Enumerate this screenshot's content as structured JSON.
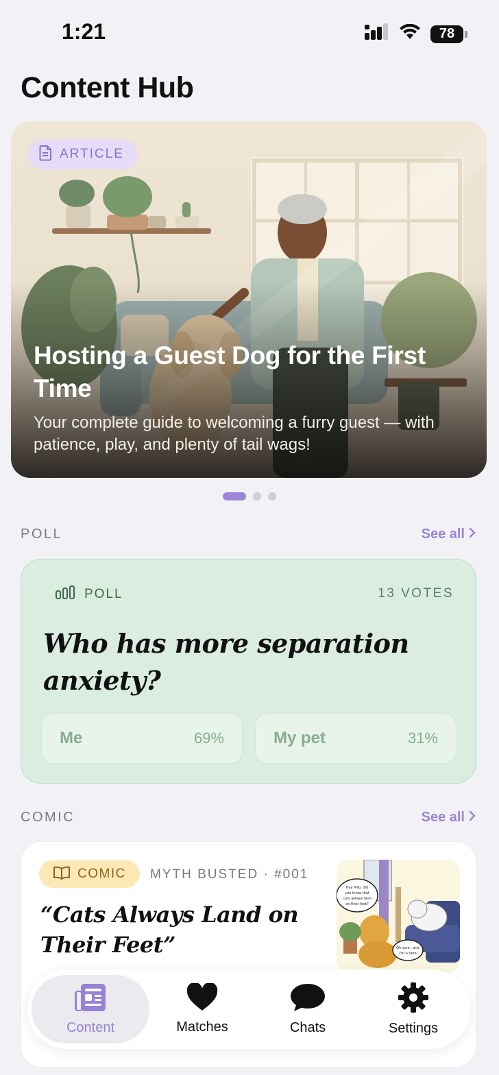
{
  "status": {
    "time": "1:21",
    "battery": "78"
  },
  "page": {
    "title": "Content Hub"
  },
  "hero": {
    "badge": "ARTICLE",
    "title": "Hosting a Guest Dog for the First Time",
    "subtitle": "Your complete guide to welcoming a furry guest — with patience, play, and plenty of tail wags!",
    "icon": "document-icon"
  },
  "carousel": {
    "count": 3,
    "active": 1
  },
  "poll_section": {
    "label": "POLL",
    "see_all": "See all",
    "card": {
      "badge": "POLL",
      "votes": "13 VOTES",
      "question": "Who has more separation anxiety?",
      "options": [
        {
          "label": "Me",
          "percent": "69%"
        },
        {
          "label": "My pet",
          "percent": "31%"
        }
      ]
    }
  },
  "comic_section": {
    "label": "COMIC",
    "see_all": "See all",
    "card": {
      "badge": "COMIC",
      "meta": "MYTH BUSTED · #001",
      "title": "“Cats Always Land on Their Feet”",
      "bubble_dog": "Hey Milo, did you know that cats always land on their feet?",
      "bubble_cat": "Oh sure.. and I'm secretly a superhero"
    }
  },
  "tabbar": {
    "tabs": [
      {
        "label": "Content",
        "icon": "newspaper-icon",
        "active": true
      },
      {
        "label": "Matches",
        "icon": "heart-icon",
        "active": false
      },
      {
        "label": "Chats",
        "icon": "chat-bubble-icon",
        "active": false
      },
      {
        "label": "Settings",
        "icon": "gear-icon",
        "active": false
      }
    ]
  },
  "colors": {
    "accent": "#9682d6",
    "poll_bg": "#daede0",
    "comic_badge_bg": "#fbe8b4",
    "article_badge_bg": "#e6dcf7"
  }
}
